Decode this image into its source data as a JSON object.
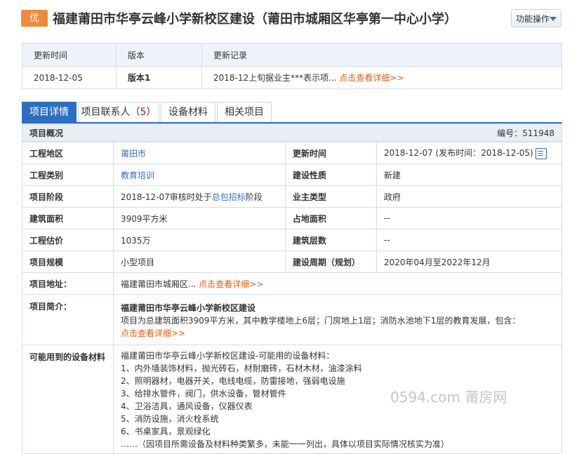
{
  "header": {
    "badge": "优",
    "title": "福建莆田市华亭云峰小学新校区建设（莆田市城厢区华亭第一中心小学）",
    "func_button": "功能操作"
  },
  "versions": {
    "columns": [
      "更新时间",
      "版本",
      "更新记录"
    ],
    "rows": [
      {
        "time": "2018-12-05",
        "version": "版本1",
        "record": "2018-12上旬据业主***表示项...",
        "link": "点击查看详细>>"
      }
    ]
  },
  "tabs": [
    {
      "label": "项目详情",
      "active": true
    },
    {
      "label": "项目联系人（",
      "count": "5",
      "suffix": "）",
      "active": false
    },
    {
      "label": "设备材料",
      "active": false
    },
    {
      "label": "相关项目",
      "active": false
    }
  ],
  "overview": {
    "title": "项目概况",
    "code": "编号：511948"
  },
  "fields": {
    "area": {
      "label": "工程地区",
      "value": "莆田市"
    },
    "update": {
      "label": "更新时间",
      "value": "2018-12-07 (发布时间：2018-12-05)"
    },
    "category": {
      "label": "工程类别",
      "value": "教育培训"
    },
    "nature": {
      "label": "建设性质",
      "value": "新建"
    },
    "stage": {
      "label": "项目阶段",
      "prefix": "2018-12-07审核时处于",
      "link": "总包招标",
      "suffix": "阶段"
    },
    "owner_type": {
      "label": "业主类型",
      "value": "政府"
    },
    "build_area": {
      "label": "建筑面积",
      "value": "3909平方米"
    },
    "land_area": {
      "label": "占地面积",
      "value": "--"
    },
    "estimate": {
      "label": "工程估价",
      "value": "1035万"
    },
    "floors": {
      "label": "建筑层数",
      "value": "--"
    },
    "scale": {
      "label": "项目规模",
      "value": "小型项目"
    },
    "period": {
      "label": "建设周期（规划）",
      "value": "2020年04月至2022年12月"
    },
    "address": {
      "label": "项目地址：",
      "value": "福建莆田市城厢区...",
      "link": "点击查看详细>>"
    },
    "intro": {
      "label": "项目简介：",
      "title": "福建莆田市华亭云峰小学新校区建设",
      "text": "项目为总建筑面积3909平方米，其中教学楼地上6层；门房地上1层；消防水池地下1层的教育发展，包含：",
      "link": "点击查看详细>>"
    },
    "materials": {
      "label": "可能用到的设备材料",
      "lines": [
        "福建莆田市华亭云峰小学新校区建设-可能用的设备材料：",
        "1、内外墙装饰材料，抛光砖石，材耐磨砖，石材木材，油漆涂料",
        "2、照明器材，电器开关，电线电缆，防雷接地，强弱电设施",
        "3、给排水管件，阀门，供水设备，管材管件",
        "4、卫浴洁具，通风设备，仪器仪表",
        "5、消防设施，消火栓系统",
        "6、书桌家具，景观绿化",
        "……（因项目所需设备及材料种类繁多，未能一一列出，具体以项目实际情况核实为准）"
      ]
    }
  },
  "watermark": "0594.com 莆房网",
  "colors": {
    "accent": "#2c6fc1",
    "badge": "#f08a3a",
    "link_orange": "#e25c0f",
    "version_red": "#c0141e"
  }
}
